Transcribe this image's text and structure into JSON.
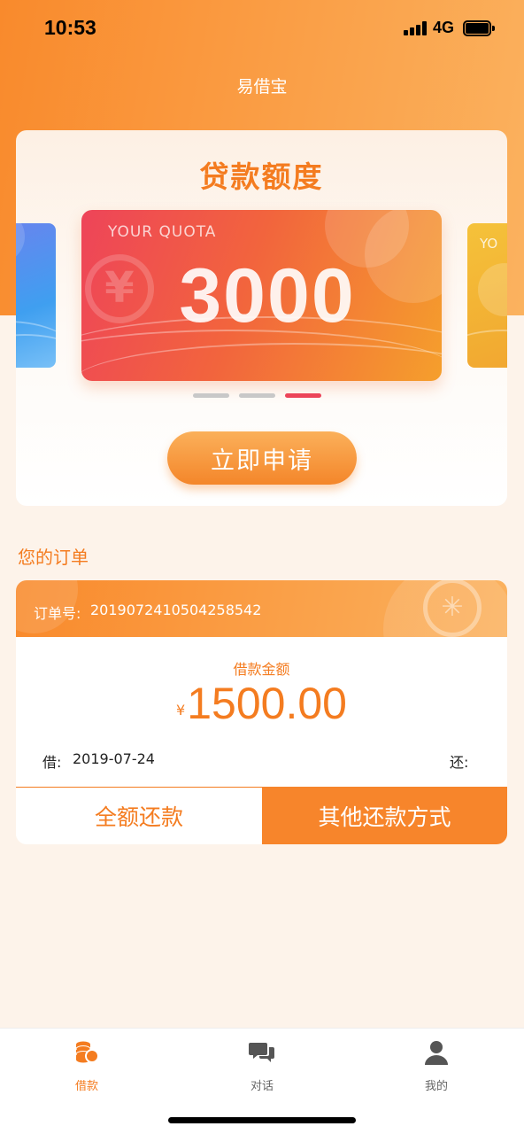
{
  "status_bar": {
    "time": "10:53",
    "network": "4G"
  },
  "header": {
    "title": "易借宝"
  },
  "quota": {
    "title": "贷款额度",
    "card_label": "YOUR QUOTA",
    "amount": "3000",
    "currency_symbol": "¥",
    "peek_text": "YO",
    "carousel_active_index": 2,
    "carousel_count": 3,
    "apply_label": "立即申请"
  },
  "orders": {
    "heading": "您的订单",
    "order_no_label": "订单号:",
    "order_no": "2019072410504258542",
    "amount_label": "借款金额",
    "currency": "¥",
    "amount": "1500.00",
    "borrow_label": "借:",
    "borrow_date": "2019-07-24",
    "repay_label": "还:",
    "full_repay_label": "全额还款",
    "other_repay_label": "其他还款方式"
  },
  "tabbar": {
    "items": [
      {
        "label": "借款",
        "icon": "coins-icon",
        "active": true
      },
      {
        "label": "对话",
        "icon": "chat-icon",
        "active": false
      },
      {
        "label": "我的",
        "icon": "user-icon",
        "active": false
      }
    ]
  },
  "colors": {
    "accent": "#f47c20",
    "active_dot": "#ec4459"
  }
}
